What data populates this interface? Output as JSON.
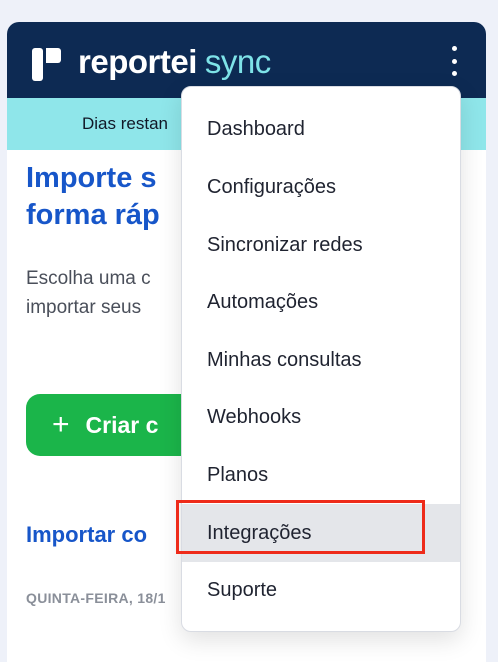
{
  "header": {
    "brand": "reportei",
    "product": "sync",
    "menu_icon": "kebab-menu-icon"
  },
  "trial_bar": {
    "text": "Dias restan"
  },
  "main": {
    "hero_title": "Importe s       \nforma ráp",
    "hero_title_lines": [
      "Importe s",
      "forma ráp"
    ],
    "hero_sub_lines": [
      "Escolha uma c",
      "importar seus"
    ],
    "create_button": {
      "icon": "plus-icon",
      "label": "Criar c"
    },
    "import_title": "Importar co",
    "date_label": "QUINTA-FEIRA, 18/1"
  },
  "menu": {
    "items": [
      {
        "label": "Dashboard"
      },
      {
        "label": "Configurações"
      },
      {
        "label": "Sincronizar redes"
      },
      {
        "label": "Automações"
      },
      {
        "label": "Minhas consultas"
      },
      {
        "label": "Webhooks"
      },
      {
        "label": "Planos"
      },
      {
        "label": "Integrações",
        "active": true
      },
      {
        "label": "Suporte"
      }
    ]
  },
  "colors": {
    "header_bg": "#0d2a53",
    "trial_bg": "#8fe6ea",
    "accent_blue": "#1756c9",
    "button_green": "#1bb54a",
    "highlight_red": "#ee2b1a"
  }
}
